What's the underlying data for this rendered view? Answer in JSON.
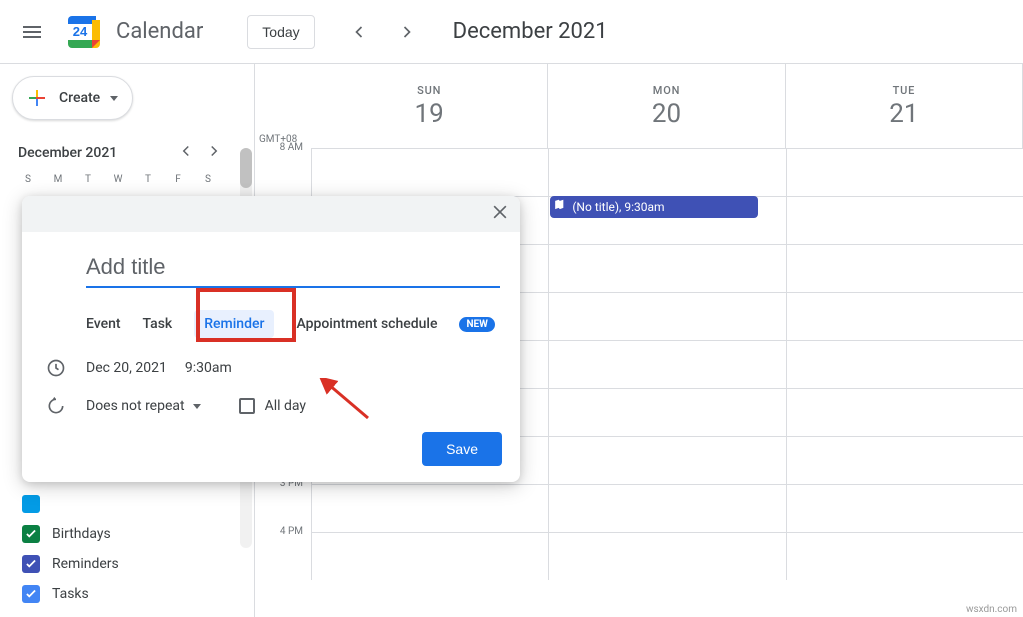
{
  "header": {
    "app_name": "Calendar",
    "today_label": "Today",
    "heading": "December 2021"
  },
  "sidebar": {
    "create_label": "Create",
    "mini_cal_title": "December 2021",
    "weekdays": [
      "S",
      "M",
      "T",
      "W",
      "T",
      "F",
      "S"
    ],
    "calendars": [
      {
        "label": "Birthdays",
        "color": "#0b8043"
      },
      {
        "label": "Reminders",
        "color": "#3f51b5"
      },
      {
        "label": "Tasks",
        "color": "#4285f4"
      }
    ]
  },
  "grid": {
    "timezone": "GMT+08",
    "days": [
      {
        "dow": "SUN",
        "num": "19"
      },
      {
        "dow": "MON",
        "num": "20"
      },
      {
        "dow": "TUE",
        "num": "21"
      }
    ],
    "times": [
      "8 AM",
      "",
      "",
      "",
      "",
      "",
      "",
      "3 PM",
      "4 PM"
    ],
    "event": {
      "title": "(No title)",
      "time": "9:30am"
    }
  },
  "dialog": {
    "placeholder": "Add title",
    "tabs": {
      "event": "Event",
      "task": "Task",
      "reminder": "Reminder",
      "appt": "Appointment schedule",
      "new": "NEW"
    },
    "date": "Dec 20, 2021",
    "time": "9:30am",
    "repeat": "Does not repeat",
    "allday": "All day",
    "save": "Save"
  },
  "watermark": "wsxdn.com"
}
